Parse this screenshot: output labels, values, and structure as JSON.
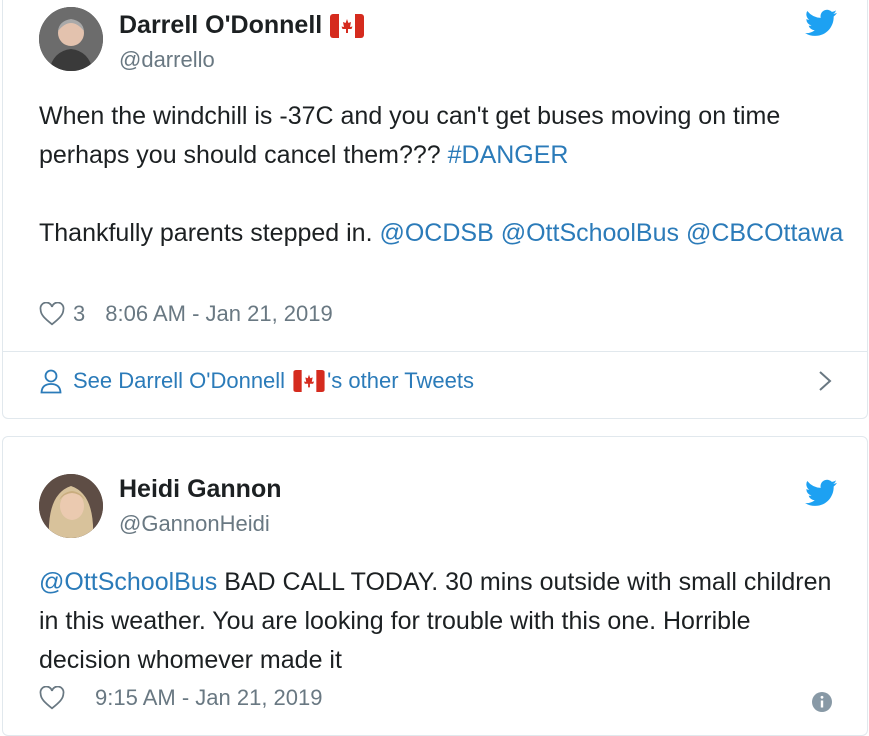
{
  "tweets": [
    {
      "author_name": "Darrell O'Donnell",
      "author_flag": "canada-flag-icon",
      "handle": "@darrello",
      "text_line1_plain": "When the windchill is -37C and you can't get buses moving on time perhaps you should cancel them??? ",
      "text_line1_hashtag": "#DANGER",
      "text_line2_plain": "Thankfully parents stepped in. ",
      "mention1": "@OCDSB",
      "mention2": "@OttSchoolBus",
      "mention3": "@CBCOttawa",
      "likes": "3",
      "timestamp": "8:06 AM - Jan 21, 2019",
      "see_more_prefix": "See Darrell O'Donnell",
      "see_more_suffix": "'s other Tweets"
    },
    {
      "author_name": "Heidi Gannon",
      "handle": "@GannonHeidi",
      "mention": "@OttSchoolBus",
      "text_plain": " BAD CALL TODAY. 30 mins outside with small children in this weather. You are looking for trouble with this one. Horrible decision whomever made it",
      "timestamp": "9:15 AM - Jan 21, 2019"
    }
  ],
  "colors": {
    "link": "#2b7bb9",
    "twitter_blue": "#1da1f2",
    "muted": "#697882",
    "text": "#1c2022",
    "border": "#e1e8ed"
  }
}
